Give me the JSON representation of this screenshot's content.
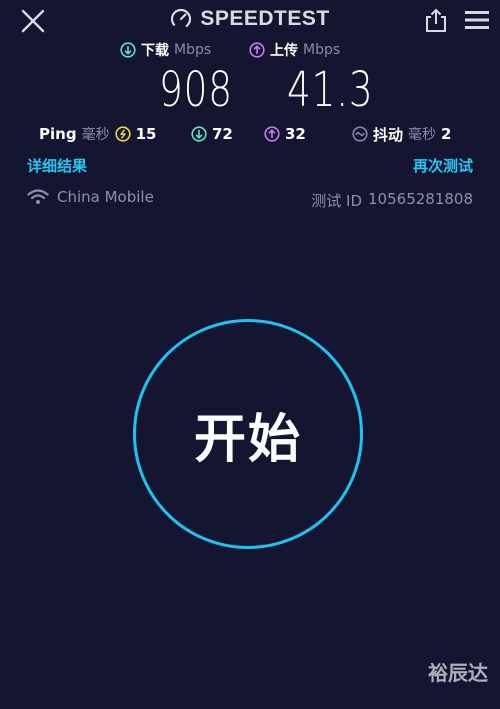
{
  "header": {
    "title": "SPEEDTEST",
    "icons": {
      "close": "close-icon",
      "logo": "speedometer-icon",
      "share": "share-icon",
      "menu": "hamburger-menu-icon"
    }
  },
  "download": {
    "label": "下载",
    "unit": "Mbps",
    "value": "908",
    "icon": "download-arrow-icon",
    "color": "#5ee3c9"
  },
  "upload": {
    "label": "上传",
    "unit": "Mbps",
    "value": "41.3",
    "icon": "upload-arrow-icon",
    "color": "#c87bf0"
  },
  "ping": {
    "label": "Ping",
    "unit": "毫秒",
    "idle": "15",
    "download": "72",
    "upload": "32",
    "idle_color": "#f2d73c"
  },
  "jitter": {
    "label": "抖动",
    "unit": "毫秒",
    "value": "2"
  },
  "links": {
    "details": "详细结果",
    "retest": "再次测试"
  },
  "connection": {
    "isp": "China Mobile",
    "icon": "wifi-icon",
    "test_id_label": "测试 ID",
    "test_id": "10565281808"
  },
  "start_button": {
    "label": "开始",
    "ring_color": "#1cc4f3"
  },
  "watermark": "裕辰达"
}
